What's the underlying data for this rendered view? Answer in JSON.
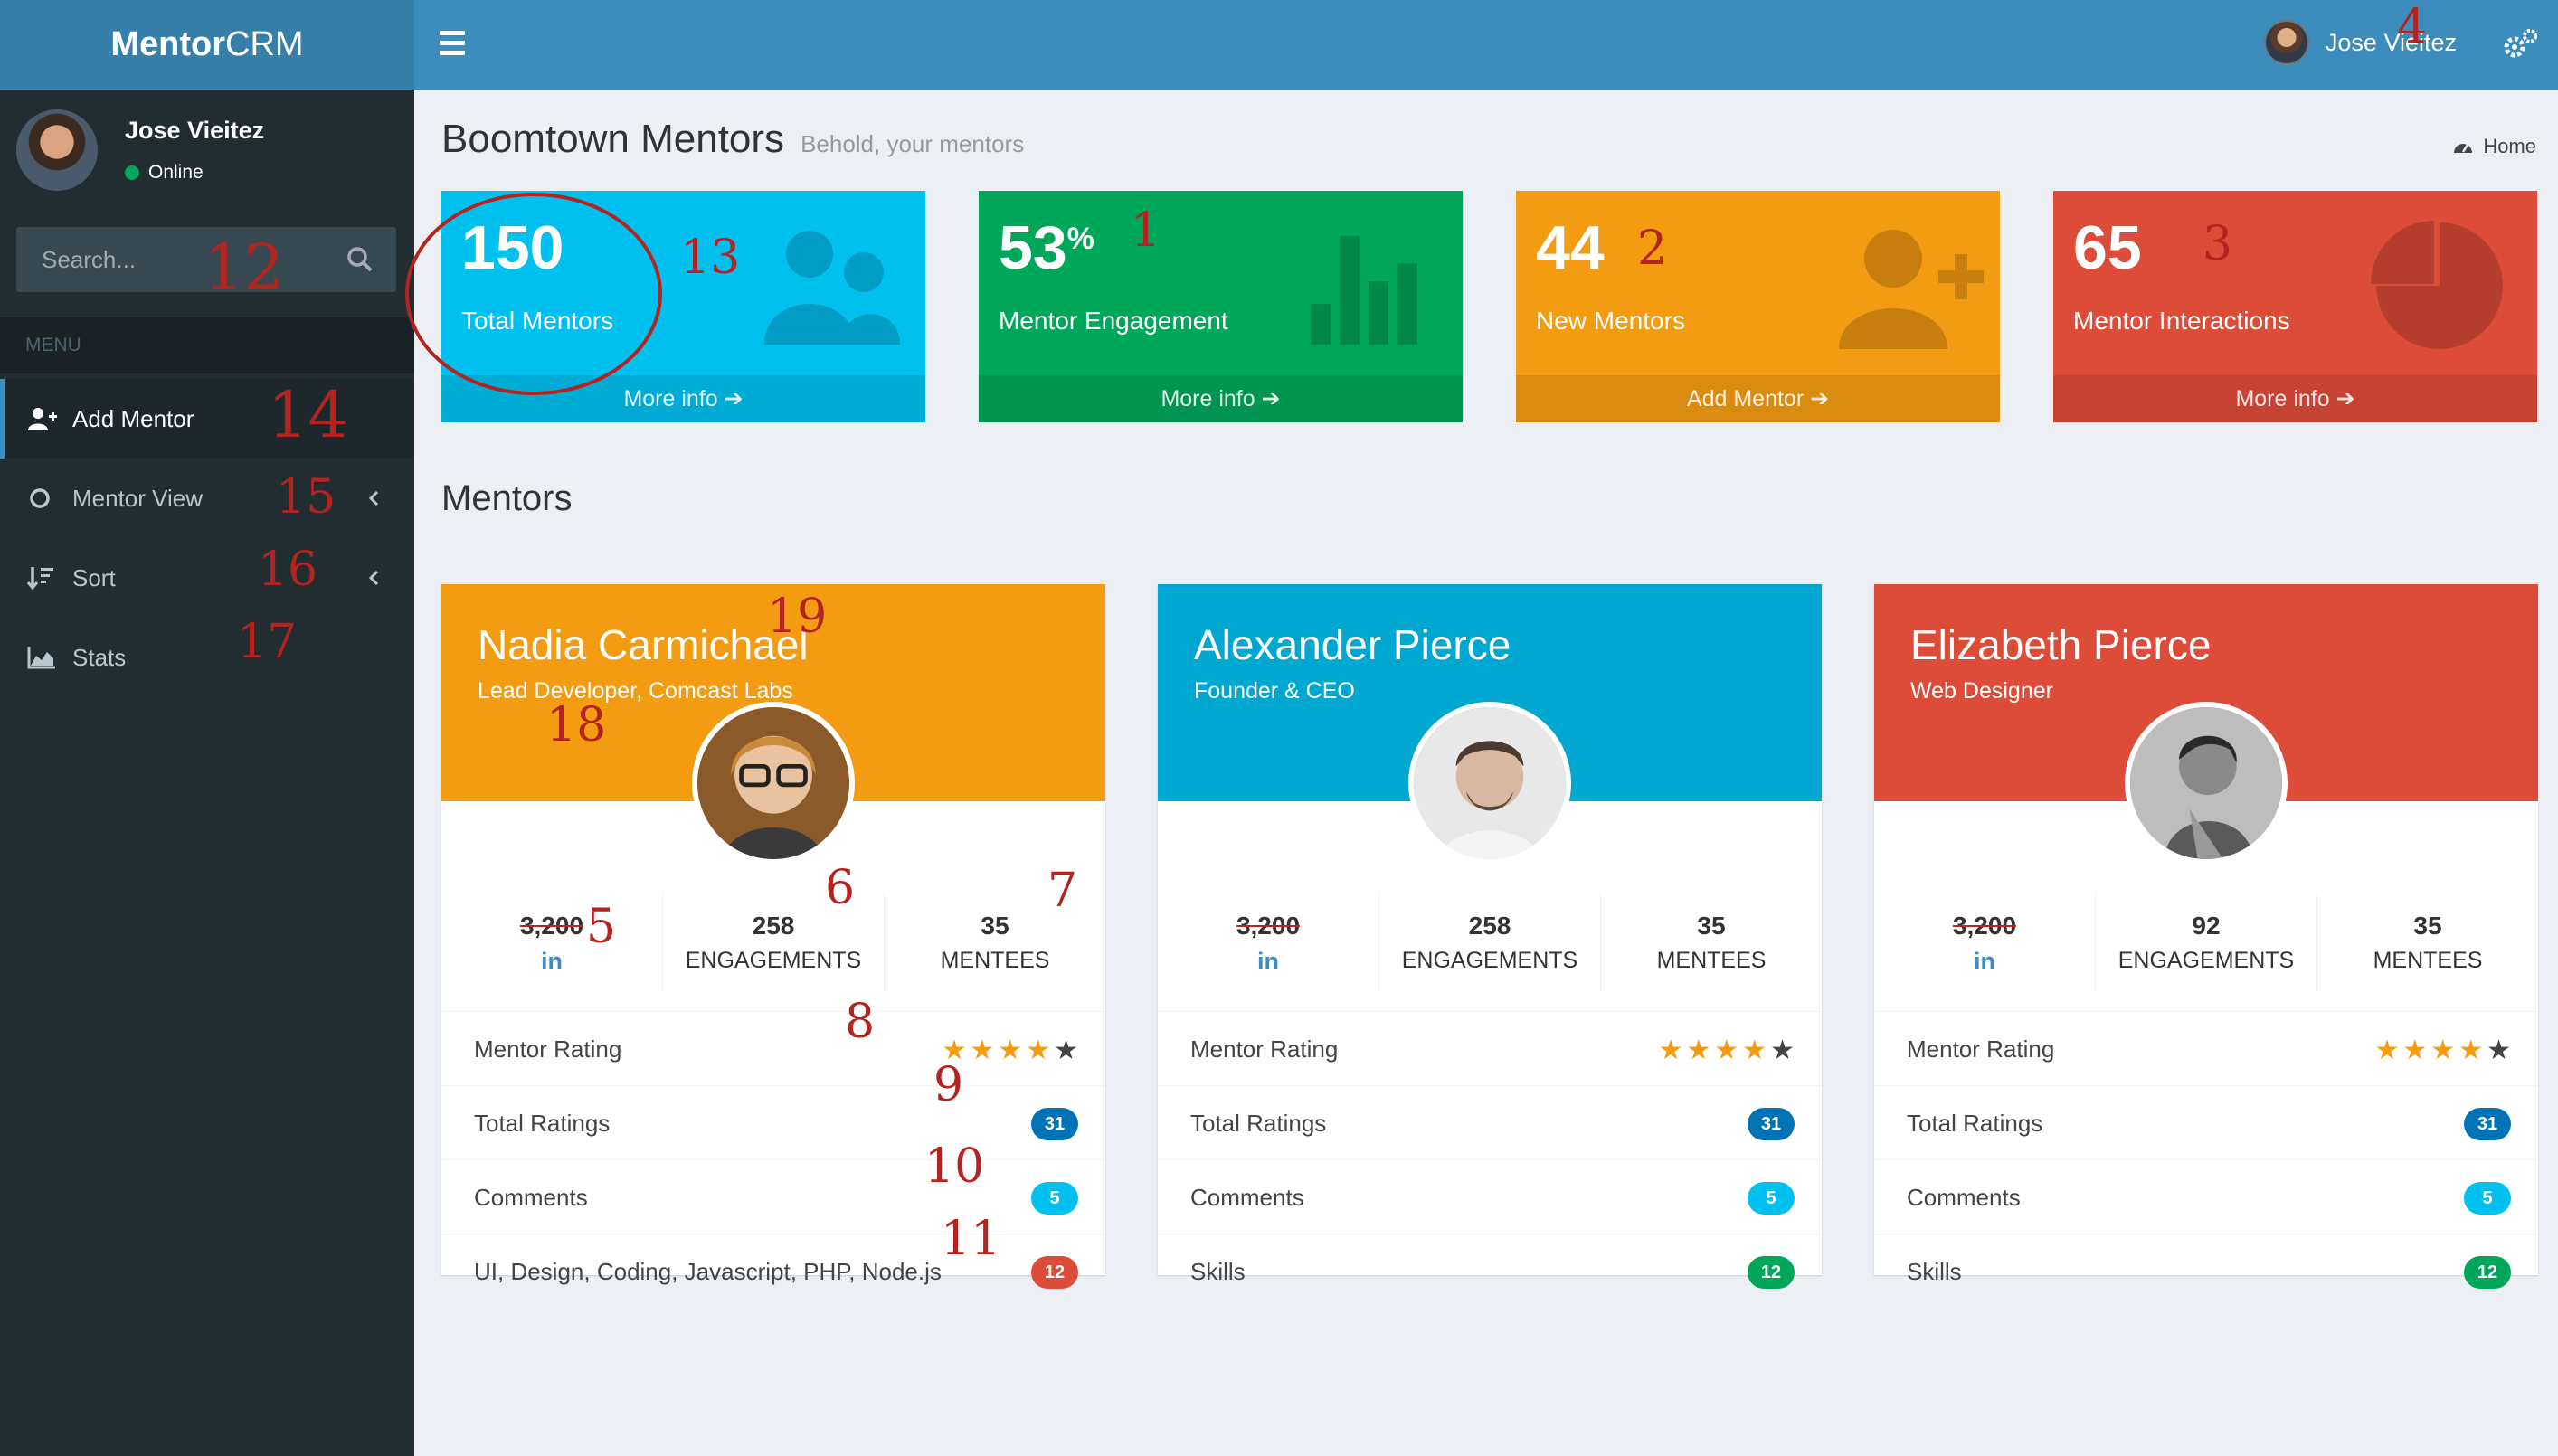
{
  "brand": {
    "bold": "Mentor",
    "light": "CRM"
  },
  "header": {
    "user_name": "Jose Vieitez"
  },
  "sidebar": {
    "user_name": "Jose Vieitez",
    "status": "Online",
    "search_placeholder": "Search...",
    "menu_header": "MENU",
    "items": [
      {
        "label": "Add Mentor",
        "icon": "user-plus-icon"
      },
      {
        "label": "Mentor View",
        "icon": "circle-icon"
      },
      {
        "label": "Sort",
        "icon": "sort-icon"
      },
      {
        "label": "Stats",
        "icon": "area-chart-icon"
      }
    ]
  },
  "page": {
    "title": "Boomtown Mentors",
    "subtitle": "Behold, your mentors",
    "breadcrumb": "Home"
  },
  "stat_boxes": [
    {
      "value": "150",
      "suffix": "",
      "label": "Total Mentors",
      "footer": "More info",
      "color": "#00c0ef"
    },
    {
      "value": "53",
      "suffix": "%",
      "label": "Mentor Engagement",
      "footer": "More info",
      "color": "#00a65a"
    },
    {
      "value": "44",
      "suffix": "",
      "label": "New Mentors",
      "footer": "Add Mentor",
      "color": "#f39c12"
    },
    {
      "value": "65",
      "suffix": "",
      "label": "Mentor Interactions",
      "footer": "More info",
      "color": "#dd4b39"
    }
  ],
  "section_title": "Mentors",
  "mentors": [
    {
      "name": "Nadia Carmichael",
      "role": "Lead Developer, Comcast Labs",
      "color": "#f39c12",
      "connections": "3,200",
      "linkedin": "in",
      "engagements": "258",
      "engagements_label": "ENGAGEMENTS",
      "mentees": "35",
      "mentees_label": "MENTEES",
      "rating_label": "Mentor Rating",
      "rating": 4,
      "total_ratings_label": "Total Ratings",
      "total_ratings": "31",
      "comments_label": "Comments",
      "comments": "5",
      "skills_label": "UI, Design, Coding, Javascript, PHP, Node.js",
      "skills": "12",
      "skills_color": "#dd4b39"
    },
    {
      "name": "Alexander Pierce",
      "role": "Founder & CEO",
      "color": "#00a7d0",
      "connections": "3,200",
      "linkedin": "in",
      "engagements": "258",
      "engagements_label": "ENGAGEMENTS",
      "mentees": "35",
      "mentees_label": "MENTEES",
      "rating_label": "Mentor Rating",
      "rating": 4,
      "total_ratings_label": "Total Ratings",
      "total_ratings": "31",
      "comments_label": "Comments",
      "comments": "5",
      "skills_label": "Skills",
      "skills": "12",
      "skills_color": "#00a65a"
    },
    {
      "name": "Elizabeth Pierce",
      "role": "Web Designer",
      "color": "#dd4b39",
      "connections": "3,200",
      "linkedin": "in",
      "engagements": "92",
      "engagements_label": "ENGAGEMENTS",
      "mentees": "35",
      "mentees_label": "MENTEES",
      "rating_label": "Mentor Rating",
      "rating": 4,
      "total_ratings_label": "Total Ratings",
      "total_ratings": "31",
      "comments_label": "Comments",
      "comments": "5",
      "skills_label": "Skills",
      "skills": "12",
      "skills_color": "#00a65a"
    }
  ],
  "annotations": [
    "1",
    "2",
    "3",
    "4",
    "5",
    "6",
    "7",
    "8",
    "9",
    "10",
    "11",
    "12",
    "13",
    "14",
    "15",
    "16",
    "17",
    "18",
    "19"
  ]
}
